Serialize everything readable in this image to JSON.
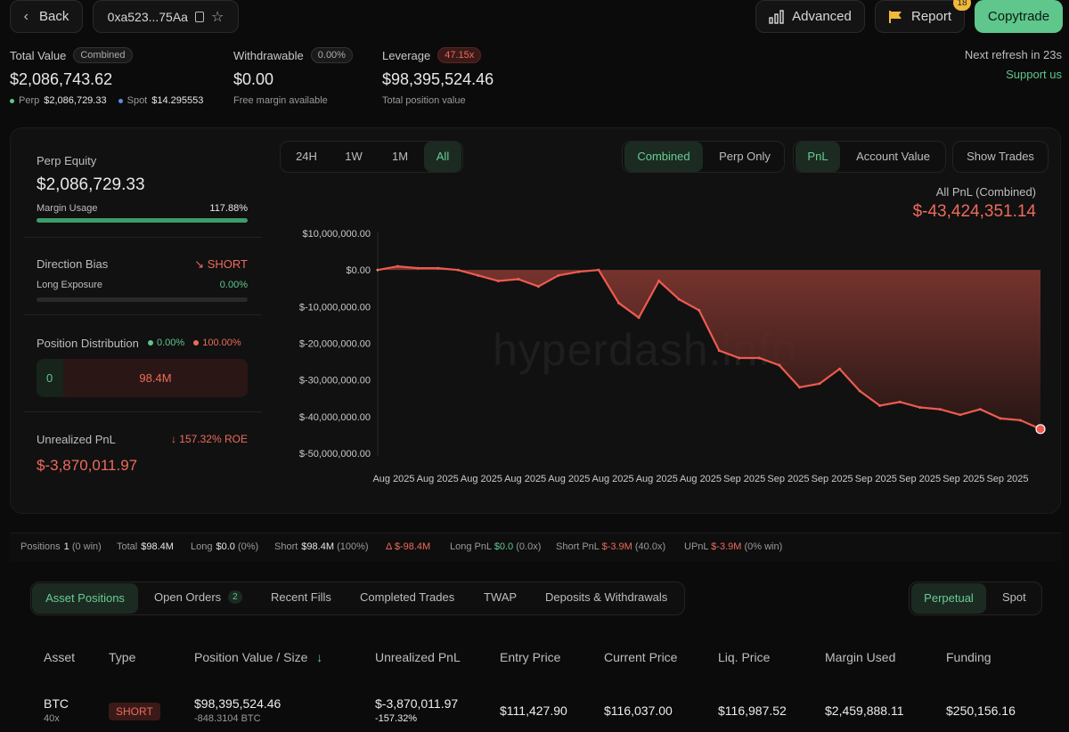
{
  "header": {
    "back_label": "Back",
    "address": "0xa523...75Aa",
    "advanced_label": "Advanced",
    "report_label": "Report",
    "report_badge": "18",
    "copytrade_label": "Copytrade"
  },
  "summary": {
    "total_value_label": "Total Value",
    "total_value_badge": "Combined",
    "total_value": "$2,086,743.62",
    "perp_label": "Perp",
    "perp_value": "$2,086,729.33",
    "spot_label": "Spot",
    "spot_value": "$14.295553",
    "withdrawable_label": "Withdrawable",
    "withdrawable_badge": "0.00%",
    "withdrawable_value": "$0.00",
    "withdrawable_sub": "Free margin available",
    "leverage_label": "Leverage",
    "leverage_badge": "47.15x",
    "leverage_value": "$98,395,524.46",
    "leverage_sub": "Total position value",
    "refresh_text": "Next refresh in 23s",
    "support_link": "Support us"
  },
  "left_panel": {
    "perp_equity_label": "Perp Equity",
    "perp_equity_value": "$2,086,729.33",
    "margin_usage_label": "Margin Usage",
    "margin_usage_value": "117.88%",
    "margin_usage_fraction": 1.0,
    "direction_bias_label": "Direction Bias",
    "direction_bias_value": "SHORT",
    "long_exposure_label": "Long Exposure",
    "long_exposure_value": "0.00%",
    "position_distribution_label": "Position Distribution",
    "dist_long_pct": "0.00%",
    "dist_short_pct": "100.00%",
    "dist_long_amount": "0",
    "dist_short_amount": "98.4M",
    "unrealized_pnl_label": "Unrealized PnL",
    "roe_value": "157.32% ROE",
    "unrealized_pnl_value": "$-3,870,011.97"
  },
  "chart_controls": {
    "ranges": [
      "24H",
      "1W",
      "1M",
      "All"
    ],
    "active_range": "All",
    "scope": [
      "Combined",
      "Perp Only"
    ],
    "active_scope": "Combined",
    "metric": [
      "PnL",
      "Account Value"
    ],
    "active_metric": "PnL",
    "show_trades_label": "Show Trades"
  },
  "chart_header": {
    "label": "All PnL (Combined)",
    "value": "$-43,424,351.14"
  },
  "watermark": "hyperdash.info",
  "chart_data": {
    "type": "area",
    "ylim": [
      -50000000,
      10000000
    ],
    "y_ticks": [
      10000000,
      0,
      -10000000,
      -20000000,
      -30000000,
      -40000000,
      -50000000
    ],
    "y_tick_labels": [
      "$10,000,000.00",
      "$0.00",
      "$-10,000,000.00",
      "$-20,000,000.00",
      "$-30,000,000.00",
      "$-40,000,000.00",
      "$-50,000,000.00"
    ],
    "x_tick_labels": [
      "Aug 2025",
      "Aug 2025",
      "Aug 2025",
      "Aug 2025",
      "Aug 2025",
      "Aug 2025",
      "Aug 2025",
      "Aug 2025",
      "Sep 2025",
      "Sep 2025",
      "Sep 2025",
      "Sep 2025",
      "Sep 2025",
      "Sep 2025",
      "Sep 2025"
    ],
    "series": [
      {
        "values": [
          0,
          1000000,
          500000,
          500000,
          0,
          -1500000,
          -3000000,
          -2500000,
          -4500000,
          -1500000,
          -500000,
          0,
          -9000000,
          -13000000,
          -3000000,
          -8000000,
          -11000000,
          -22000000,
          -24000000,
          -24000000,
          -26000000,
          -32000000,
          -31000000,
          -27000000,
          -33000000,
          -37000000,
          -36000000,
          -37500000,
          -38000000,
          -39500000,
          -38000000,
          -40500000,
          -41000000,
          -43400000
        ]
      }
    ],
    "grid": false,
    "colors": {
      "line": "#ee5a4f",
      "fill_top": "#8a3a33",
      "fill_bottom": "#2a1715"
    }
  },
  "stats_bar": {
    "positions_label": "Positions",
    "positions_value": "1",
    "positions_win": "(0 win)",
    "total_label": "Total",
    "total_value": "$98.4M",
    "long_label": "Long",
    "long_value": "$0.0",
    "long_pct": "(0%)",
    "short_label": "Short",
    "short_value": "$98.4M",
    "short_pct": "(100%)",
    "delta_label": "Δ",
    "delta_value": "$-98.4M",
    "long_pnl_label": "Long PnL",
    "long_pnl_value": "$0.0",
    "long_pnl_x": "(0.0x)",
    "short_pnl_label": "Short PnL",
    "short_pnl_value": "$-3.9M",
    "short_pnl_x": "(40.0x)",
    "upnl_label": "UPnL",
    "upnl_value": "$-3.9M",
    "upnl_win": "(0% win)"
  },
  "tabs": {
    "asset_positions": "Asset Positions",
    "open_orders": "Open Orders",
    "open_orders_count": "2",
    "recent_fills": "Recent Fills",
    "completed_trades": "Completed Trades",
    "twap": "TWAP",
    "deposits": "Deposits & Withdrawals",
    "perpetual": "Perpetual",
    "spot": "Spot"
  },
  "table": {
    "headers": [
      "Asset",
      "Type",
      "Position Value / Size",
      "Unrealized PnL",
      "Entry Price",
      "Current Price",
      "Liq. Price",
      "Margin Used",
      "Funding"
    ],
    "row": {
      "asset": "BTC",
      "leverage": "40x",
      "type": "SHORT",
      "position_value": "$98,395,524.46",
      "size": "-848.3104 BTC",
      "upnl": "$-3,870,011.97",
      "upnl_pct": "-157.32%",
      "entry": "$111,427.90",
      "current": "$116,037.00",
      "liq": "$116,987.52",
      "margin": "$2,459,888.11",
      "funding": "$250,156.16"
    }
  }
}
